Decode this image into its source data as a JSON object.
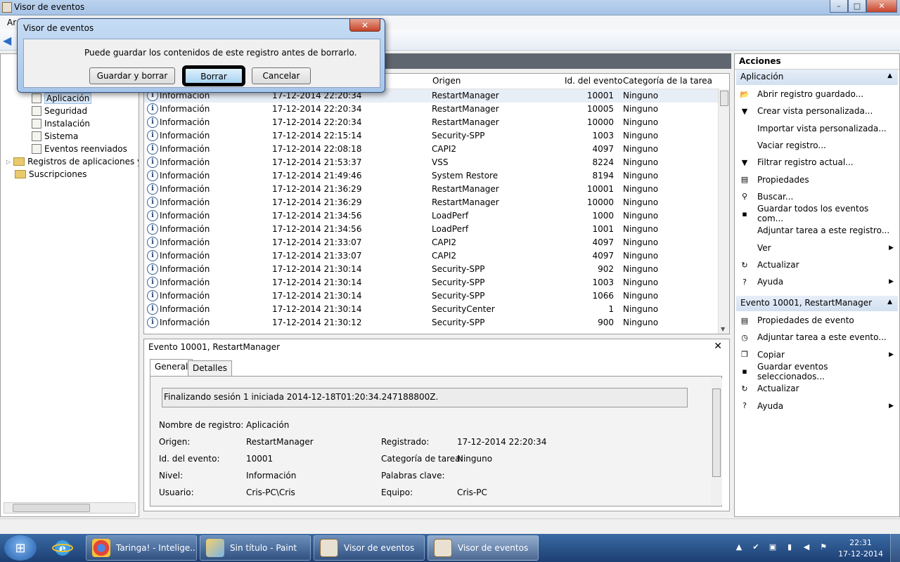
{
  "window": {
    "title": "Visor de eventos",
    "menu_partial": "Ar",
    "controls": {
      "minimize": "–",
      "maximize": "□",
      "close": "✕"
    }
  },
  "tree": {
    "items": [
      {
        "label": "Aplicación",
        "selected": true
      },
      {
        "label": "Seguridad"
      },
      {
        "label": "Instalación"
      },
      {
        "label": "Sistema"
      },
      {
        "label": "Eventos reenviados"
      },
      {
        "label": "Registros de aplicaciones y s"
      },
      {
        "label": "Suscripciones"
      }
    ]
  },
  "grid": {
    "columns": [
      "Origen",
      "Id. del evento",
      "Categoría de la tarea"
    ],
    "rows": [
      {
        "level": "Información",
        "date": "17-12-2014 22:20:34",
        "source": "RestartManager",
        "id": "10001",
        "category": "Ninguno"
      },
      {
        "level": "Información",
        "date": "17-12-2014 22:20:34",
        "source": "RestartManager",
        "id": "10005",
        "category": "Ninguno"
      },
      {
        "level": "Información",
        "date": "17-12-2014 22:20:34",
        "source": "RestartManager",
        "id": "10000",
        "category": "Ninguno"
      },
      {
        "level": "Información",
        "date": "17-12-2014 22:15:14",
        "source": "Security-SPP",
        "id": "1003",
        "category": "Ninguno"
      },
      {
        "level": "Información",
        "date": "17-12-2014 22:08:18",
        "source": "CAPI2",
        "id": "4097",
        "category": "Ninguno"
      },
      {
        "level": "Información",
        "date": "17-12-2014 21:53:37",
        "source": "VSS",
        "id": "8224",
        "category": "Ninguno"
      },
      {
        "level": "Información",
        "date": "17-12-2014 21:49:46",
        "source": "System Restore",
        "id": "8194",
        "category": "Ninguno"
      },
      {
        "level": "Información",
        "date": "17-12-2014 21:36:29",
        "source": "RestartManager",
        "id": "10001",
        "category": "Ninguno"
      },
      {
        "level": "Información",
        "date": "17-12-2014 21:36:29",
        "source": "RestartManager",
        "id": "10000",
        "category": "Ninguno"
      },
      {
        "level": "Información",
        "date": "17-12-2014 21:34:56",
        "source": "LoadPerf",
        "id": "1000",
        "category": "Ninguno"
      },
      {
        "level": "Información",
        "date": "17-12-2014 21:34:56",
        "source": "LoadPerf",
        "id": "1001",
        "category": "Ninguno"
      },
      {
        "level": "Información",
        "date": "17-12-2014 21:33:07",
        "source": "CAPI2",
        "id": "4097",
        "category": "Ninguno"
      },
      {
        "level": "Información",
        "date": "17-12-2014 21:33:07",
        "source": "CAPI2",
        "id": "4097",
        "category": "Ninguno"
      },
      {
        "level": "Información",
        "date": "17-12-2014 21:30:14",
        "source": "Security-SPP",
        "id": "902",
        "category": "Ninguno"
      },
      {
        "level": "Información",
        "date": "17-12-2014 21:30:14",
        "source": "Security-SPP",
        "id": "1003",
        "category": "Ninguno"
      },
      {
        "level": "Información",
        "date": "17-12-2014 21:30:14",
        "source": "Security-SPP",
        "id": "1066",
        "category": "Ninguno"
      },
      {
        "level": "Información",
        "date": "17-12-2014 21:30:14",
        "source": "SecurityCenter",
        "id": "1",
        "category": "Ninguno"
      },
      {
        "level": "Información",
        "date": "17-12-2014 21:30:12",
        "source": "Security-SPP",
        "id": "900",
        "category": "Ninguno"
      }
    ]
  },
  "detail": {
    "title": "Evento 10001, RestartManager",
    "close": "✕",
    "tabs": [
      "General",
      "Detalles"
    ],
    "message": "Finalizando sesión 1 iniciada 2014-12-18T01:20:34.247188800Z.",
    "fields": [
      {
        "label": "Nombre de registro:",
        "value": "Aplicación"
      },
      {
        "label": "Origen:",
        "value": "RestartManager"
      },
      {
        "label": "Id. del evento:",
        "value": "10001"
      },
      {
        "label": "Nivel:",
        "value": "Información"
      },
      {
        "label": "Usuario:",
        "value": "Cris-PC\\Cris"
      }
    ],
    "fields_right": [
      {
        "label": "Registrado:",
        "value": "17-12-2014 22:20:34"
      },
      {
        "label": "Categoría de tarea:",
        "value": "Ninguno"
      },
      {
        "label": "Palabras clave:",
        "value": ""
      },
      {
        "label": "Equipo:",
        "value": "Cris-PC"
      }
    ]
  },
  "actions": {
    "title": "Acciones",
    "section1": "Aplicación",
    "items1": [
      {
        "label": "Abrir registro guardado...",
        "icon": "folder-open-icon"
      },
      {
        "label": "Crear vista personalizada...",
        "icon": "filter-icon"
      },
      {
        "label": "Importar vista personalizada...",
        "icon": ""
      },
      {
        "label": "Vaciar registro...",
        "icon": ""
      },
      {
        "label": "Filtrar registro actual...",
        "icon": "filter-icon"
      },
      {
        "label": "Propiedades",
        "icon": "properties-icon"
      },
      {
        "label": "Buscar...",
        "icon": "binoculars-icon"
      },
      {
        "label": "Guardar todos los eventos com...",
        "icon": "save-icon"
      },
      {
        "label": "Adjuntar tarea a este registro...",
        "icon": ""
      },
      {
        "label": "Ver",
        "icon": "",
        "submenu": true
      },
      {
        "label": "Actualizar",
        "icon": "refresh-icon"
      },
      {
        "label": "Ayuda",
        "icon": "help-icon",
        "submenu": true
      }
    ],
    "section2": "Evento 10001, RestartManager",
    "items2": [
      {
        "label": "Propiedades de evento",
        "icon": "properties-icon"
      },
      {
        "label": "Adjuntar tarea a este evento...",
        "icon": "task-icon"
      },
      {
        "label": "Copiar",
        "icon": "copy-icon",
        "submenu": true
      },
      {
        "label": "Guardar eventos seleccionados...",
        "icon": "save-icon"
      },
      {
        "label": "Actualizar",
        "icon": "refresh-icon"
      },
      {
        "label": "Ayuda",
        "icon": "help-icon",
        "submenu": true
      }
    ]
  },
  "dialog": {
    "title": "Visor de eventos",
    "close": "✕",
    "message": "Puede guardar los contenidos de este registro antes de borrarlo.",
    "buttons": {
      "save_clear": "Guardar y borrar",
      "clear": "Borrar",
      "cancel": "Cancelar"
    }
  },
  "taskbar": {
    "buttons": [
      {
        "label": "Taringa! - Intelige..."
      },
      {
        "label": "Sin título - Paint"
      },
      {
        "label": "Visor de eventos"
      },
      {
        "label": "Visor de eventos"
      }
    ],
    "time": "22:31",
    "date": "17-12-2014"
  },
  "colors": {
    "titlebar": "#a5c2e6",
    "taskbar": "#1d3f73",
    "selection": "#d9e7f7",
    "focus_button": "#a6d4f2"
  }
}
